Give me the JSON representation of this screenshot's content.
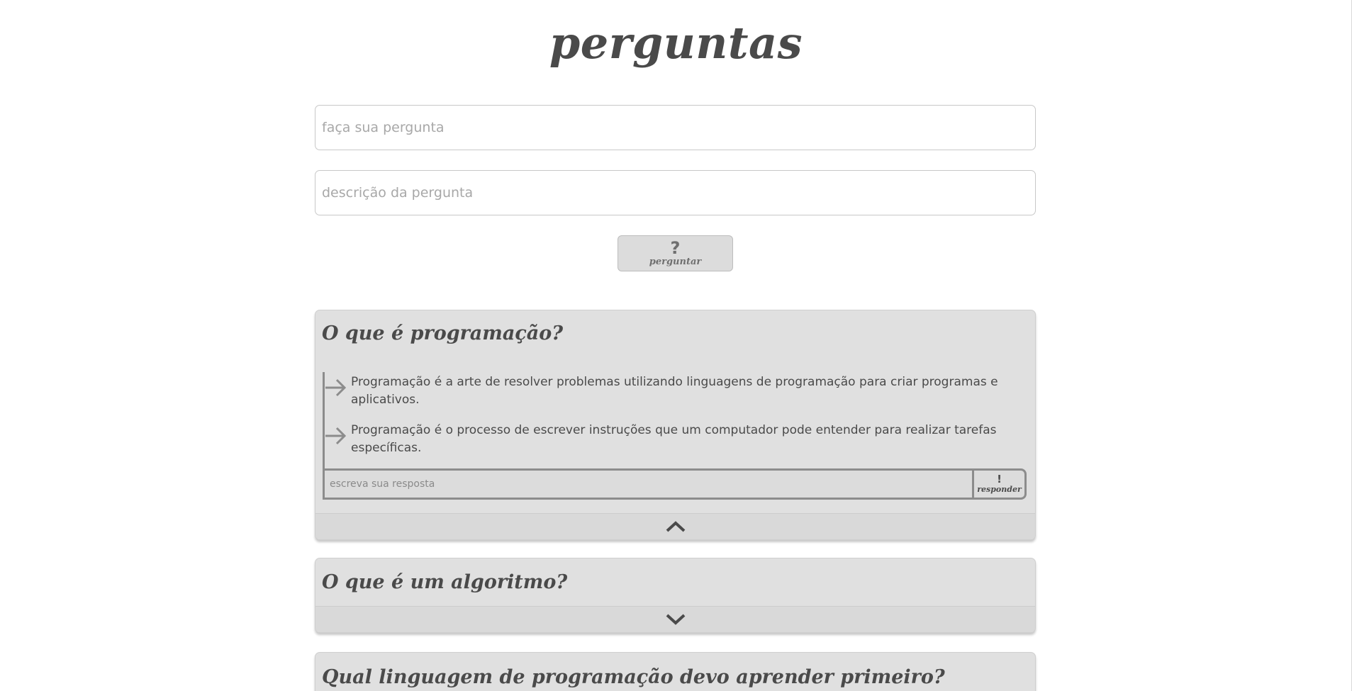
{
  "page": {
    "title": "perguntas"
  },
  "form": {
    "question_placeholder": "faça sua pergunta",
    "description_placeholder": "descrição da pergunta",
    "ask_button": {
      "symbol": "?",
      "label": "perguntar"
    }
  },
  "questions": [
    {
      "title": "O que é programação?",
      "expanded": true,
      "toggle_icon": "chevron-up-icon",
      "answers": [
        "Programação é a arte de resolver problemas utilizando linguagens de programação para criar programas e aplicativos.",
        "Programação é o processo de escrever instruções que um computador pode entender para realizar tarefas específicas."
      ],
      "reply_placeholder": "escreva sua resposta",
      "reply_button": {
        "symbol": "!",
        "label": "responder"
      }
    },
    {
      "title": "O que é um algoritmo?",
      "expanded": false,
      "toggle_icon": "chevron-down-icon"
    },
    {
      "title": "Qual linguagem de programação devo aprender primeiro?",
      "expanded": false
    }
  ],
  "colors": {
    "text": "#4a4a4a",
    "card_background": "#e0e0e0",
    "accent_gray": "#8c8c8c",
    "button_background": "#dcdcdc"
  }
}
